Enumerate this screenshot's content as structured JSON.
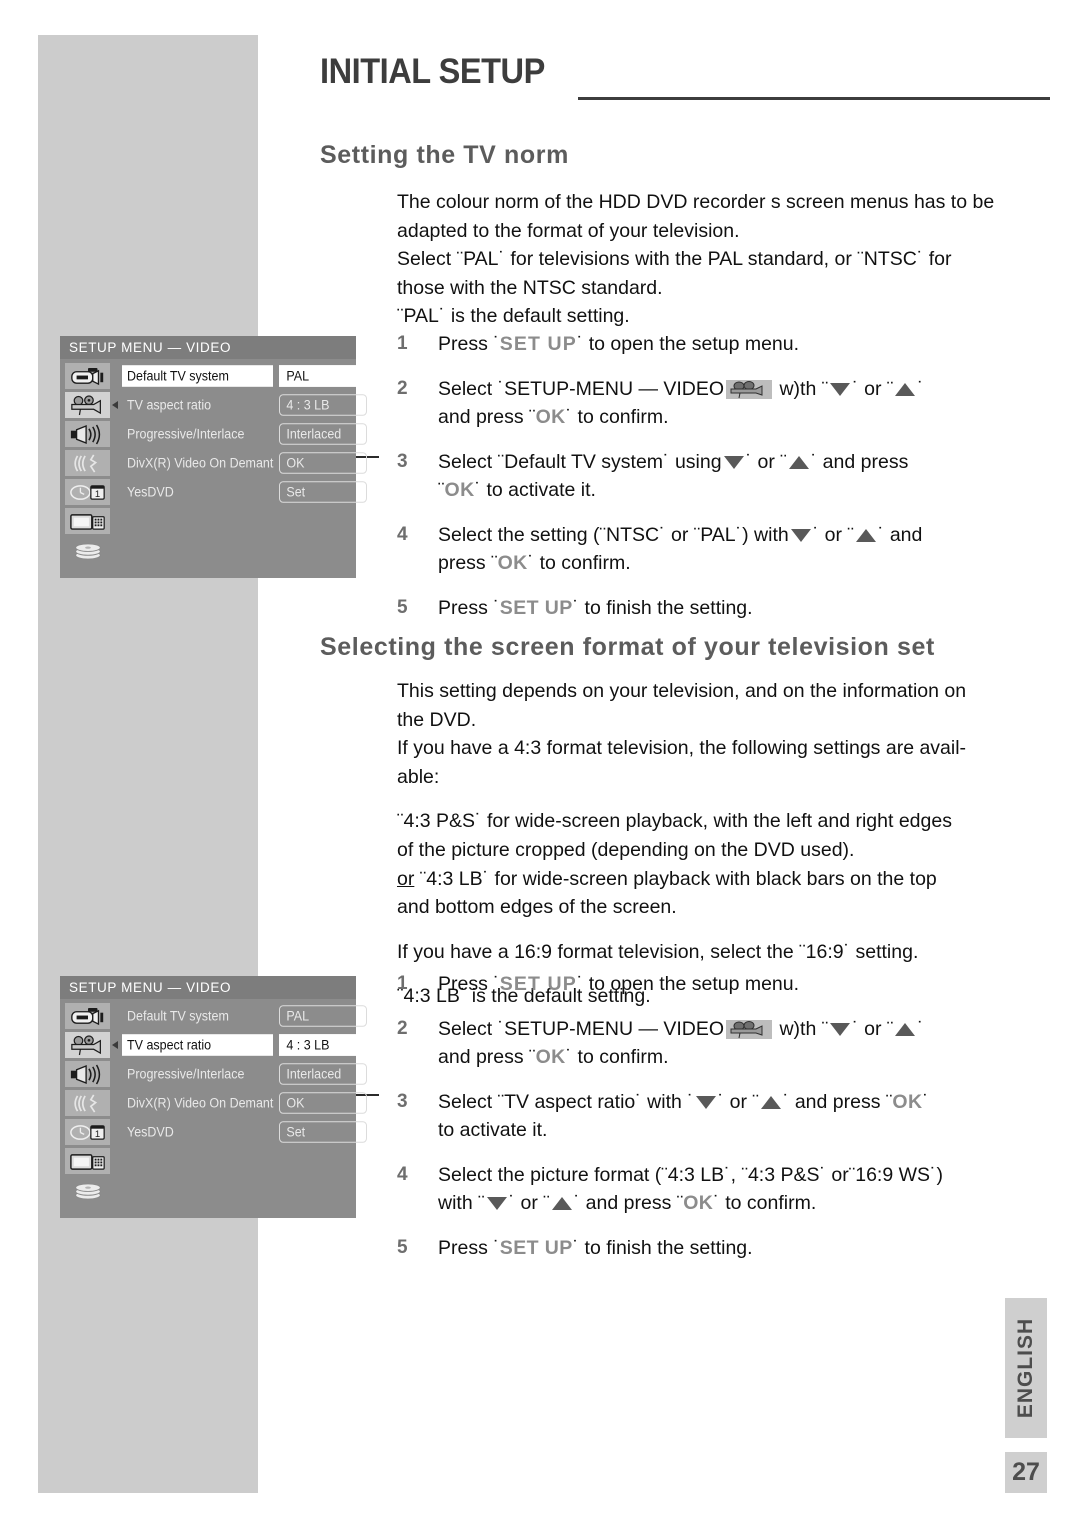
{
  "page": {
    "title": "INITIAL SETUP",
    "number": "27",
    "language_tab": "ENGLISH"
  },
  "sections": [
    {
      "heading": "Setting the TV norm",
      "paragraphs": [
        "The colour norm of the HDD DVD recorder s screen menus has to be adapted to the format of your television.",
        "Select ¨PAL˙ for televisions with the PAL standard, or ¨NTSC˙ for those with the NTSC standard.",
        "¨PAL˙ is the default setting."
      ],
      "steps": [
        {
          "num": "1",
          "text": "Press ˙SET UP˙ to open the setup menu."
        },
        {
          "num": "2",
          "text": "Select ˙SETUP-MENU — VIDEO with ¨ ▼ ˙ or ¨ ▲ ˙ and press ¨OK˙ to confirm."
        },
        {
          "num": "3",
          "text": "Select ¨Default TV system˙ using ▼ ˙ or ¨ ▲ ˙ and press ¨ OK˙ to activate it."
        },
        {
          "num": "4",
          "text": "Select the setting (¨NTSC˙ or ¨PAL˙) with ▼ ˙ or ¨ ▲ ˙ and press ¨OK˙ to confirm."
        },
        {
          "num": "5",
          "text": "Press ˙SET UP˙ to finish the setting."
        }
      ]
    },
    {
      "heading": "Selecting the screen format of your television set",
      "paragraphs": [
        "This setting depends on your television, and on the information on the DVD.",
        "If you have a 4:3 format television, the following settings are available:",
        "¨4:3 P&S˙ for wide-screen playback, with the left and right edges of the picture cropped (depending on the DVD used).",
        "or ¨4:3 LB˙ for wide-screen playback with black bars on the top and bottom edges of the screen.",
        "If you have a 16:9 format television, select the ¨16:9˙ setting.",
        "¨4:3 LB˙ is the default setting."
      ],
      "steps": [
        {
          "num": "1",
          "text": "Press ˙SET UP˙ to open the setup menu."
        },
        {
          "num": "2",
          "text": "Select ˙SETUP-MENU — VIDEO with ¨ ▼ ˙ or ¨ ▲ ˙ and press ¨OK˙ to confirm."
        },
        {
          "num": "3",
          "text": "Select ¨TV aspect ratio˙ with ˙▼ ˙ or ¨ ▲ ˙ and press ¨ OK˙ to activate it."
        },
        {
          "num": "4",
          "text": "Select the picture format (¨4:3 LB˙, ¨4:3 P&S˙ or¨16:9 WS˙) with ¨ ▼ ˙ or ¨ ▲ ˙ and press ¨OK˙ to confirm."
        },
        {
          "num": "5",
          "text": "Press ˙SET UP˙ to finish the setting."
        }
      ]
    }
  ],
  "text_fragments": {
    "p1_line_a": "The colour norm of the HDD DVD recorder s screen menus has to be",
    "p1_line_b": "adapted to the format of your television.",
    "p1_line_c": "Select ¨PAL˙ for televisions with the PAL standard, or ¨NTSC˙ for",
    "p1_line_d": "those with the NTSC standard.",
    "p1_line_e": "¨PAL˙ is the default setting.",
    "p2_line_a": "This setting depends on your television, and on the information on",
    "p2_line_b": "the DVD.",
    "p2_line_c": "If you have a 4:3 format television, the following settings are avail-",
    "p2_line_d": "able:",
    "p2_line_e": "¨4:3 P&S˙ for wide-screen playback, with the left and right edges",
    "p2_line_f": "of the picture cropped (depending on the DVD used).",
    "p2_line_g_or": "or",
    "p2_line_g": "¨4:3 LB˙ for wide-screen playback with black bars on the top",
    "p2_line_h": "and bottom edges of the screen.",
    "p2_line_i": "If you have a 16:9 format television, select the ¨16:9˙ setting.",
    "p2_line_j": "¨4:3 LB˙ is the default setting.",
    "s1_press": "Press",
    "s1_setup_key": "SET UP",
    "s1_rest": "˙ to open the setup menu.",
    "s2_select": "Select ˙SETUP-MENU — VIDEO",
    "s2_with": "w)th ¨",
    "s2_or": "˙ or ¨",
    "s2_end": "˙",
    "s2_line2_a": "and press ¨",
    "s2_ok": "OK",
    "s2_line2_b": "˙ to confirm.",
    "s3a_select": "Select ¨Default TV system˙ using",
    "s3a_or": "˙ or ¨",
    "s3a_and_press": "˙ and press",
    "s3a_line2_a": "¨",
    "s3a_ok": "OK",
    "s3a_line2_b": "˙ to activate it.",
    "s4a_select": "Select the setting (¨NTSC˙ or ¨PAL˙) with",
    "s4a_or": "˙ or ¨",
    "s4a_and": "˙ and",
    "s4a_line2_a": "press ¨",
    "s4a_ok": "OK",
    "s4a_line2_b": "˙ to confirm.",
    "s5_press": "Press",
    "s5_setup_key": "SET UP",
    "s5_rest": "˙ to finish the setting.",
    "s3b_select": "Select ¨TV aspect ratio˙ with ˙",
    "s3b_or": "˙ or ¨",
    "s3b_and_press": "˙ and press ¨",
    "s3b_ok": "OK",
    "s3b_tail": "˙",
    "s3b_line2": "to activate it.",
    "s4b_select": "Select the picture format (¨4:3 LB˙, ¨4:3 P&S˙ or¨16:9 WS˙)",
    "s4b_with": "with ¨",
    "s4b_or": "˙ or ¨",
    "s4b_and_press": "˙ and press ¨",
    "s4b_ok": "OK",
    "s4b_end": "˙ to confirm."
  },
  "setup_menu": {
    "title": "SETUP MENU — VIDEO",
    "icons": [
      "camcorder-icon",
      "film-camera-icon",
      "speaker-icon",
      "sound-waves-icon",
      "clock-calendar-icon",
      "tv-keypad-icon",
      "disc-stack-icon"
    ],
    "rows": [
      {
        "label": "Default TV system",
        "value": "PAL"
      },
      {
        "label": "TV aspect ratio",
        "value": "4 : 3 LB"
      },
      {
        "label": "Progressive/Interlace",
        "value": "Interlaced"
      },
      {
        "label": "DivX(R) Video On Demant",
        "value": "OK"
      },
      {
        "label": "YesDVD",
        "value": "Set"
      }
    ],
    "screenshot_1_selected_row": 0,
    "screenshot_2_selected_row": 1
  },
  "colors": {
    "band_gray": "#cccccc",
    "menu_bg": "#8c8c8c",
    "menu_title_bg": "#7d7d7d",
    "key_gray": "#8c8c8c",
    "heading_gray": "#5c5c5c"
  }
}
